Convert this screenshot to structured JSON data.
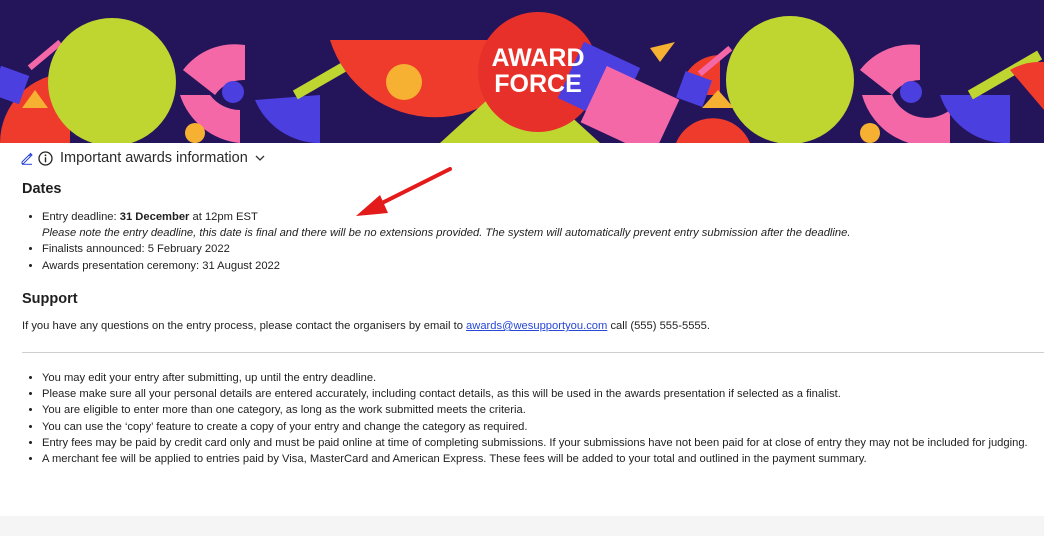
{
  "banner": {
    "logo_line1": "AWARD",
    "logo_line2": "FORCE"
  },
  "info_bar": {
    "title": "Important awards information",
    "edit_icon": "pencil-icon",
    "info_icon": "info-circle-icon",
    "toggle_icon": "chevron-down-icon"
  },
  "dates": {
    "heading": "Dates",
    "entry_deadline_prefix": "Entry deadline: ",
    "entry_deadline_date": "31 December",
    "entry_deadline_suffix": " at 12pm EST",
    "entry_deadline_note": "Please note the entry deadline, this date is final and there will be no extensions provided. The system will automatically prevent entry submission after the deadline.",
    "finalists": "Finalists announced: 5 February 2022",
    "ceremony": "Awards presentation ceremony: 31 August 2022"
  },
  "support": {
    "heading": "Support",
    "text_before": "If you have any questions on the entry process, please contact the organisers by email to ",
    "email": "awards@wesupportyou.com",
    "text_after": " call (555) 555-5555."
  },
  "rules": [
    "You may edit your entry after submitting, up until the entry deadline.",
    "Please make sure all your personal details are entered accurately, including contact details, as this will be used in the awards presentation if selected as a finalist.",
    "You are eligible to enter more than one category, as long as the work submitted meets the criteria.",
    "You can use the ‘copy’ feature to create a copy of your entry and change the category as required.",
    "Entry fees may be paid by credit card only and must be paid online at time of completing submissions. If your submissions have not been paid for at close of entry they may not be included for judging.",
    "A merchant fee will be applied to entries paid by Visa, MasterCard and American Express. These fees will be added to your total and outlined in the payment summary."
  ],
  "colors": {
    "banner_bg": "#24145a",
    "logo_red": "#e8302a",
    "lime": "#bfd530",
    "pink": "#f468a8",
    "blue": "#4b3fe0",
    "orange": "#f6b032",
    "link": "#2747d6",
    "annotation_arrow": "#e31b1b"
  }
}
